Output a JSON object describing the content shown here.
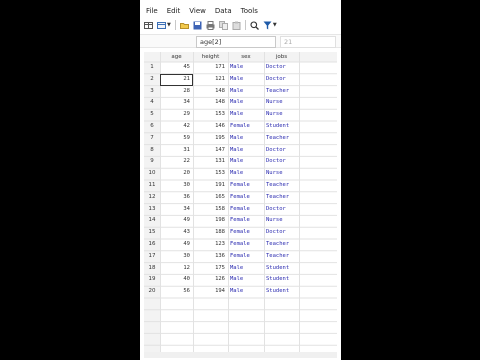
{
  "menu": [
    "File",
    "Edit",
    "View",
    "Data",
    "Tools"
  ],
  "command": {
    "value": "age[2]",
    "value2": "21"
  },
  "columns": [
    "age",
    "height",
    "sex",
    "jobs"
  ],
  "rows": [
    [
      "45",
      "171",
      "Male",
      "Doctor"
    ],
    [
      "21",
      "121",
      "Male",
      "Doctor"
    ],
    [
      "28",
      "148",
      "Male",
      "Teacher"
    ],
    [
      "34",
      "148",
      "Male",
      "Nurse"
    ],
    [
      "29",
      "153",
      "Male",
      "Nurse"
    ],
    [
      "42",
      "146",
      "Female",
      "Student"
    ],
    [
      "59",
      "195",
      "Male",
      "Teacher"
    ],
    [
      "31",
      "147",
      "Male",
      "Doctor"
    ],
    [
      "22",
      "131",
      "Male",
      "Doctor"
    ],
    [
      "20",
      "153",
      "Male",
      "Nurse"
    ],
    [
      "30",
      "191",
      "Female",
      "Teacher"
    ],
    [
      "36",
      "165",
      "Female",
      "Teacher"
    ],
    [
      "34",
      "158",
      "Female",
      "Doctor"
    ],
    [
      "49",
      "198",
      "Female",
      "Nurse"
    ],
    [
      "43",
      "188",
      "Female",
      "Doctor"
    ],
    [
      "49",
      "123",
      "Female",
      "Teacher"
    ],
    [
      "30",
      "136",
      "Female",
      "Teacher"
    ],
    [
      "12",
      "175",
      "Male",
      "Student"
    ],
    [
      "40",
      "126",
      "Male",
      "Student"
    ],
    [
      "56",
      "194",
      "Male",
      "Student"
    ]
  ],
  "colors": {
    "string": "#2a2ab0",
    "number": "#333333",
    "filter": "#1e5aa8"
  }
}
